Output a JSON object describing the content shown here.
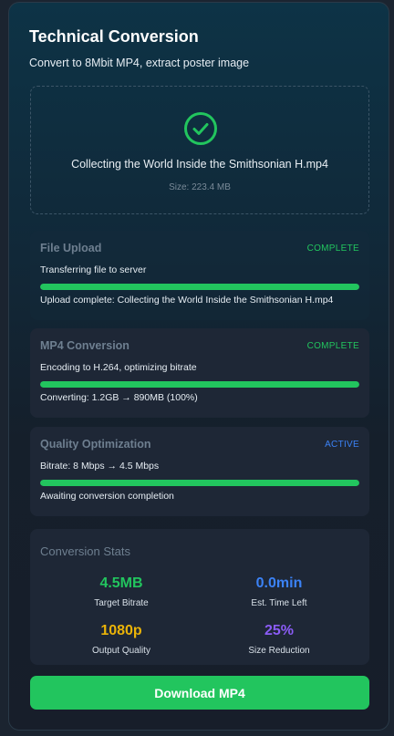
{
  "header": {
    "title": "Technical Conversion",
    "subtitle": "Convert to 8Mbit MP4, extract poster image"
  },
  "file": {
    "name": "Collecting the World Inside the Smithsonian H.mp4",
    "size": "Size: 223.4 MB",
    "status_icon": "check-circle-icon"
  },
  "steps": [
    {
      "title": "File Upload",
      "status": "COMPLETE",
      "description": "Transferring file to server",
      "progress": 100,
      "note": "Upload complete: Collecting the World Inside the Smithsonian H.mp4"
    },
    {
      "title": "MP4 Conversion",
      "status": "COMPLETE",
      "description": "Encoding to H.264, optimizing bitrate",
      "progress": 100,
      "note": "Converting: 1.2GB → 890MB (100%)"
    },
    {
      "title": "Quality Optimization",
      "status": "ACTIVE",
      "description": "Bitrate: 8 Mbps → 4.5 Mbps",
      "progress": 100,
      "note": "Awaiting conversion completion"
    }
  ],
  "stats": {
    "title": "Conversion Stats",
    "items": [
      {
        "value": "4.5MB",
        "label": "Target Bitrate",
        "color": "#22c55e"
      },
      {
        "value": "0.0min",
        "label": "Est. Time Left",
        "color": "#3b82f6"
      },
      {
        "value": "1080p",
        "label": "Output Quality",
        "color": "#eab308"
      },
      {
        "value": "25%",
        "label": "Size Reduction",
        "color": "#8b5cf6"
      }
    ]
  },
  "actions": {
    "download_label": "Download MP4"
  },
  "colors": {
    "accent": "#22c55e",
    "active": "#3b82f6"
  }
}
